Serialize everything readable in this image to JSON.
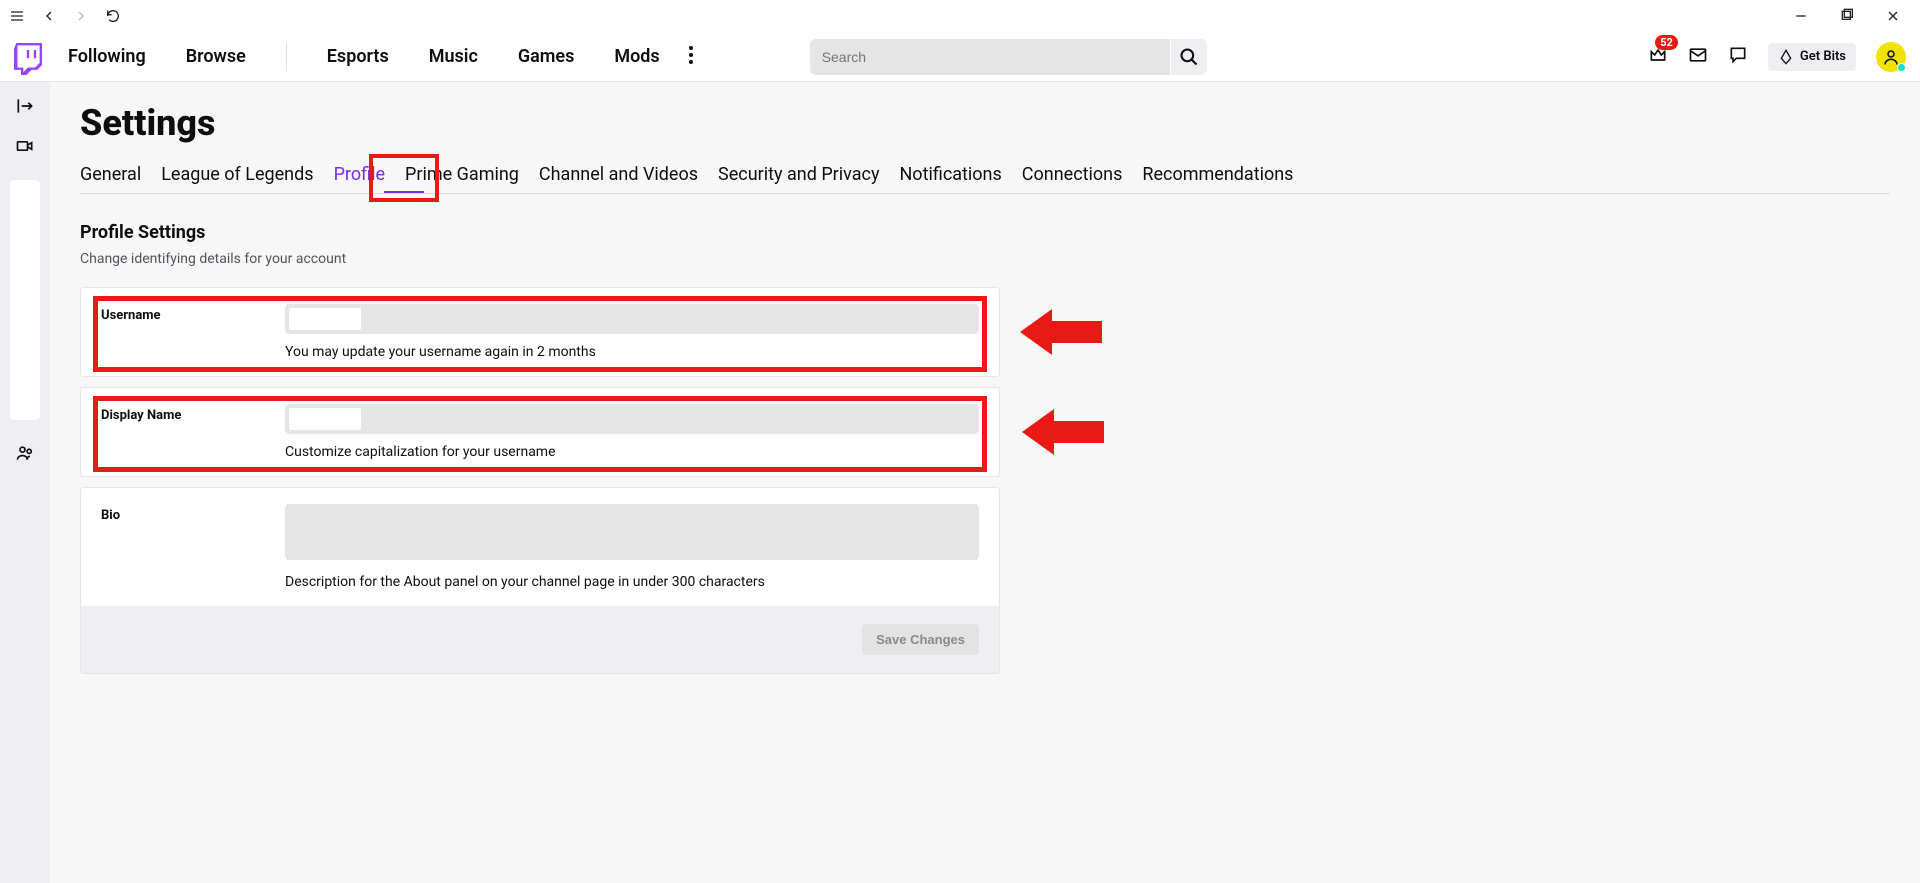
{
  "chrome": {
    "notification_badge": "52",
    "get_bits_label": "Get Bits"
  },
  "nav": {
    "links": [
      "Following",
      "Browse",
      "Esports",
      "Music",
      "Games",
      "Mods"
    ],
    "search_placeholder": "Search"
  },
  "page": {
    "title": "Settings",
    "tabs": [
      "General",
      "League of Legends",
      "Profile",
      "Prime Gaming",
      "Channel and Videos",
      "Security and Privacy",
      "Notifications",
      "Connections",
      "Recommendations"
    ],
    "active_tab_index": 2,
    "section_title": "Profile Settings",
    "section_sub": "Change identifying details for your account",
    "fields": {
      "username": {
        "label": "Username",
        "help": "You may update your username again in 2 months"
      },
      "display_name": {
        "label": "Display Name",
        "help": "Customize capitalization for your username"
      },
      "bio": {
        "label": "Bio",
        "help": "Description for the About panel on your channel page in under 300 characters"
      }
    },
    "save_button": "Save Changes"
  }
}
